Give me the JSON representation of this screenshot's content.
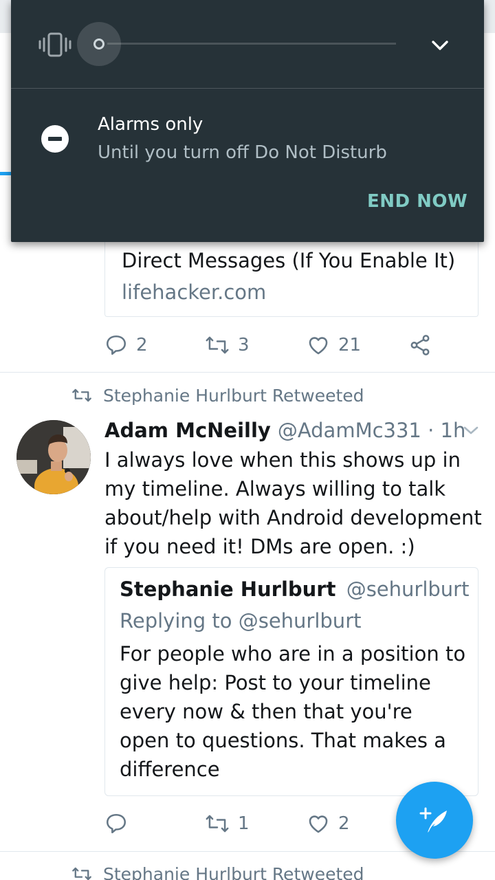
{
  "dnd": {
    "title": "Alarms only",
    "subtitle": "Until you turn off Do Not Disturb",
    "end_label": "END NOW",
    "volume_level": 0.0
  },
  "link_card": {
    "title": "Direct Messages (If You Enable It)",
    "domain": "lifehacker.com"
  },
  "tweet1_actions": {
    "replies": "2",
    "retweets": "3",
    "likes": "21"
  },
  "tweet2": {
    "retweeted_by": "Stephanie Hurlburt Retweeted",
    "name": "Adam McNeilly",
    "meta": "@AdamMc331 · 1h",
    "text": "I always love when this shows up in my timeline. Always willing to talk about/help with Android development if you need it! DMs are open. :)",
    "quote": {
      "name": "Stephanie Hurlburt",
      "handle": "@sehurlburt",
      "reply": "Replying to @sehurlburt",
      "text": "For people who are in a position to give help: Post to your timeline every now & then that you're open to questions. That makes a difference"
    },
    "actions": {
      "replies": "",
      "retweets": "1",
      "likes": "2"
    }
  },
  "tweet3": {
    "retweeted_by": "Stephanie Hurlburt Retweeted"
  },
  "colors": {
    "accent": "#1da1f2",
    "panel": "#263238",
    "end_now": "#80cbc4"
  },
  "icons": [
    "vibrate-icon",
    "chevron-down-icon",
    "do-not-disturb-icon",
    "reply-icon",
    "retweet-icon",
    "like-icon",
    "share-icon",
    "compose-tweet-icon"
  ]
}
